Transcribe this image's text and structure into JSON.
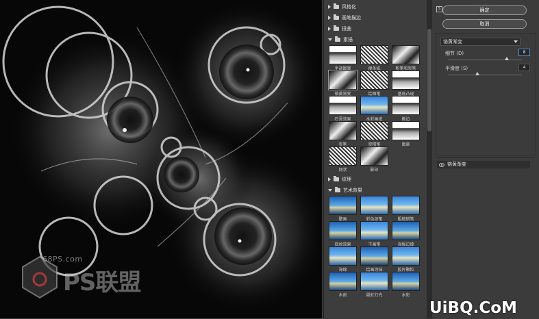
{
  "watermark": {
    "site": "68PS.com",
    "brand": "PS联盟",
    "corner": "UiBQ.CoM"
  },
  "filter_gallery": {
    "categories": [
      {
        "label": "风格化",
        "open": false
      },
      {
        "label": "画笔描边",
        "open": false
      },
      {
        "label": "扭曲",
        "open": false
      },
      {
        "label": "素描",
        "open": true
      }
    ],
    "sketch_filters": [
      "半调图案",
      "便条纸",
      "粉笔和炭笔",
      "铬黄渐变",
      "绘图笔",
      "基底凸现",
      "石膏效果",
      "水彩画纸",
      "撕边",
      "炭笔",
      "炭精笔",
      "图章",
      "网状",
      "影印"
    ],
    "texture_category": {
      "label": "纹理",
      "open": false
    },
    "art_category": {
      "label": "艺术效果",
      "open": true
    },
    "art_filters": [
      "壁画",
      "彩色铅笔",
      "粗糙蜡笔",
      "底纹效果",
      "干画笔",
      "海报边缘",
      "海绵",
      "绘画涂抹",
      "胶片颗粒",
      "木刻",
      "霓虹灯光",
      "水彩"
    ]
  },
  "buttons": {
    "ok": "确定",
    "cancel": "取消"
  },
  "ps_badge": "S",
  "settings": {
    "selected_filter": "铬黄渐变",
    "detail_label": "细节 (D)",
    "detail_value": "8",
    "smooth_label": "平滑度 (S)",
    "smooth_value": "4",
    "detail_fraction": 0.8,
    "smooth_fraction": 0.4
  },
  "layers": {
    "current": "铬黄渐变"
  }
}
